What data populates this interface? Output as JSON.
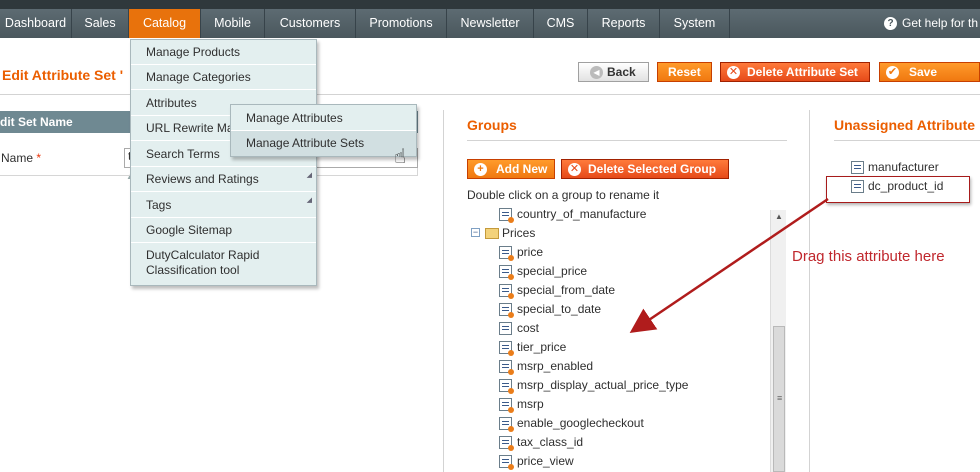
{
  "nav": {
    "items": [
      "Dashboard",
      "Sales",
      "Catalog",
      "Mobile",
      "Customers",
      "Promotions",
      "Newsletter",
      "CMS",
      "Reports",
      "System"
    ],
    "help": "Get help for th"
  },
  "header": {
    "title": "Edit Attribute Set '",
    "back": "Back",
    "reset": "Reset",
    "delete_set": "Delete Attribute Set",
    "save": "Save Attribut"
  },
  "left_panel": {
    "section_title": "dit Set Name",
    "name_label": "Name",
    "required_mark": "*",
    "name_value": "t"
  },
  "catalog_menu": {
    "items": [
      "Manage Products",
      "Manage Categories",
      "Attributes",
      "URL Rewrite Ma",
      "Search Terms",
      "Reviews and Ratings",
      "Tags",
      "Google Sitemap",
      "DutyCalculator Rapid",
      "Classification tool"
    ]
  },
  "attributes_submenu": {
    "items": [
      "Manage Attributes",
      "Manage Attribute Sets"
    ]
  },
  "groups": {
    "title": "Groups",
    "add_new": "Add New",
    "delete_group": "Delete Selected Group",
    "hint": "Double click on a group to rename it",
    "tree": {
      "top_item": "country_of_manufacture",
      "group": "Prices",
      "items": [
        "price",
        "special_price",
        "special_from_date",
        "special_to_date",
        "cost",
        "tier_price",
        "msrp_enabled",
        "msrp_display_actual_price_type",
        "msrp",
        "enable_googlecheckout",
        "tax_class_id",
        "price_view"
      ]
    }
  },
  "unassigned": {
    "title": "Unassigned Attribute",
    "items": [
      "manufacturer",
      "dc_product_id"
    ]
  },
  "annotation": {
    "text": "Drag this attribute here",
    "color": "#c0272d"
  },
  "colors": {
    "accent": "#eb5e00",
    "nav_active": "#e8720c",
    "nav_bg": "#4a575d"
  }
}
